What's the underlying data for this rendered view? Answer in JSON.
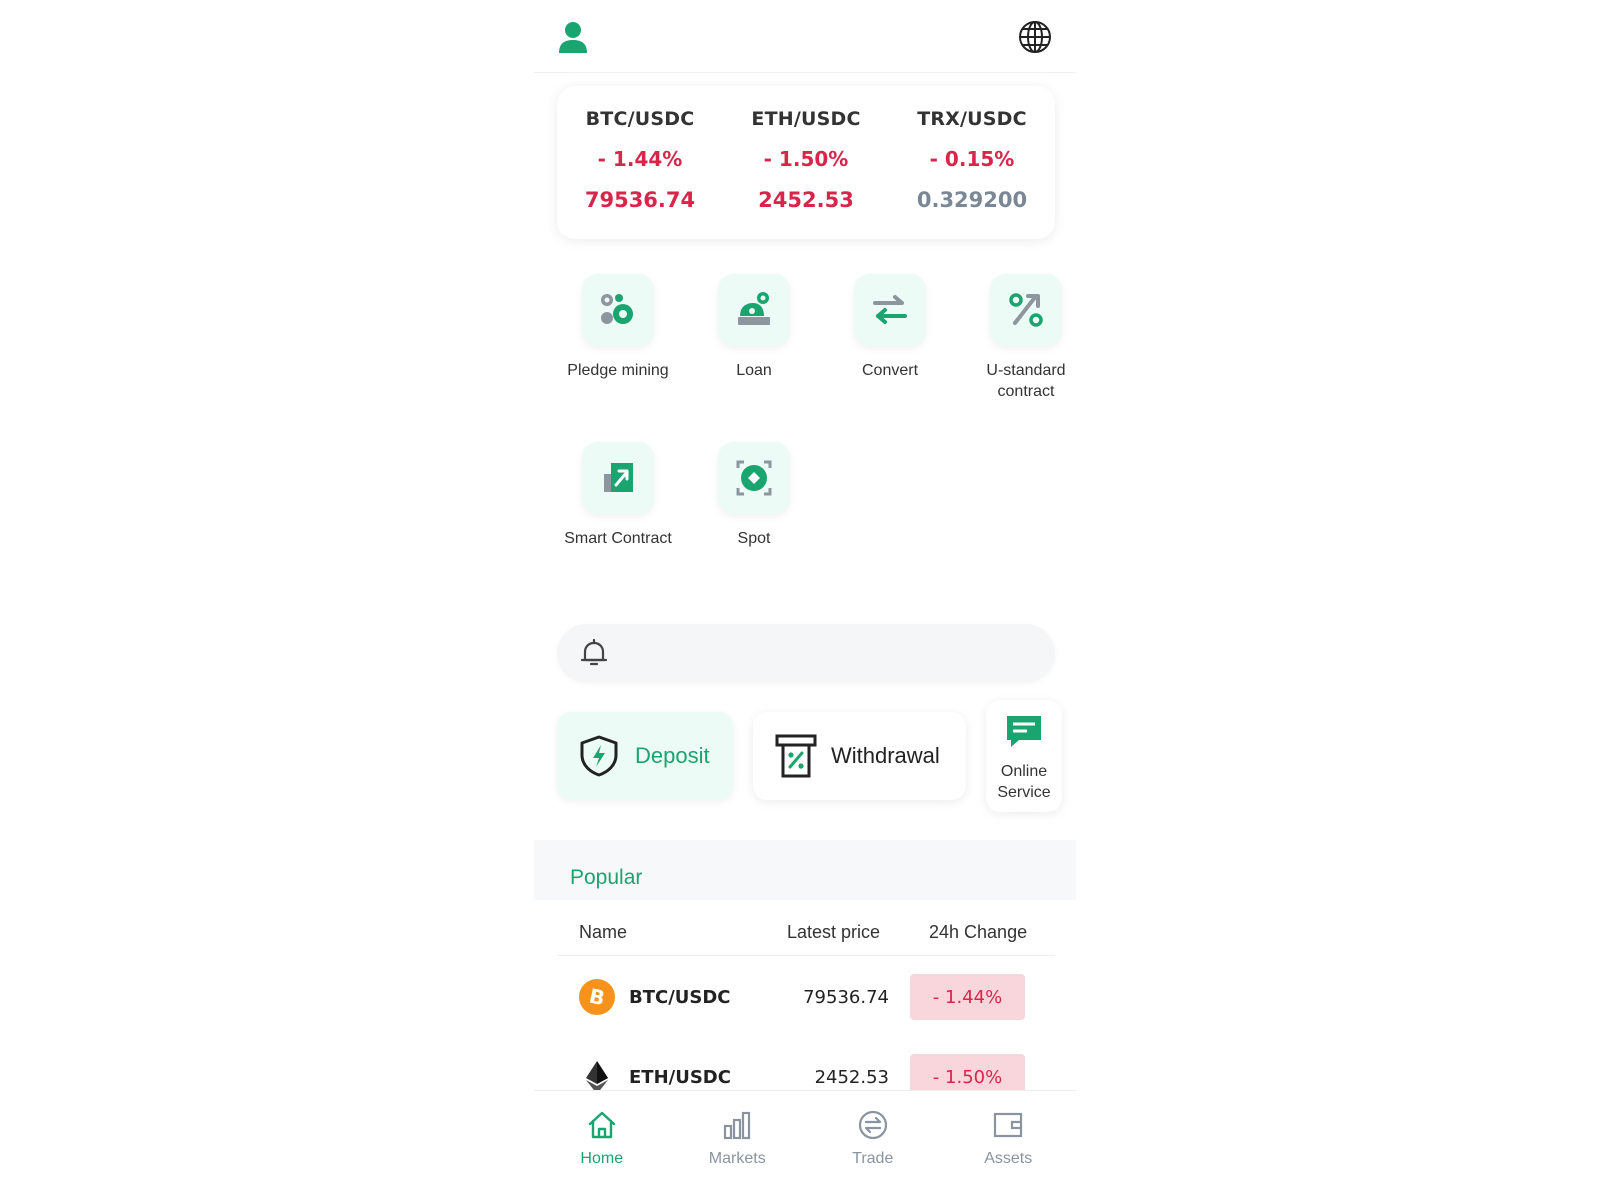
{
  "header": {
    "avatar_icon": "user-avatar-icon",
    "language_icon": "globe-icon"
  },
  "tickers": [
    {
      "pair": "BTC/USDC",
      "change": "- 1.44%",
      "price": "79536.74",
      "trend": "down"
    },
    {
      "pair": "ETH/USDC",
      "change": "- 1.50%",
      "price": "2452.53",
      "trend": "down"
    },
    {
      "pair": "TRX/USDC",
      "change": "- 0.15%",
      "price": "0.329200",
      "trend": "flat"
    }
  ],
  "quick_menu": [
    {
      "label": "Pledge mining",
      "icon": "pledge-mining-icon"
    },
    {
      "label": "Loan",
      "icon": "loan-icon"
    },
    {
      "label": "Convert",
      "icon": "convert-arrows-icon"
    },
    {
      "label": "U-standard contract",
      "icon": "percent-contract-icon"
    },
    {
      "label": "Smart Contract",
      "icon": "smart-contract-icon"
    },
    {
      "label": "Spot",
      "icon": "spot-icon"
    }
  ],
  "notice": {
    "icon": "bell-icon",
    "text": ""
  },
  "actions": {
    "deposit_label": "Deposit",
    "withdrawal_label": "Withdrawal",
    "service_label": "Online Service"
  },
  "popular": {
    "title": "Popular",
    "columns": {
      "name": "Name",
      "price": "Latest price",
      "change": "24h Change"
    },
    "rows": [
      {
        "pair": "BTC/USDC",
        "price": "79536.74",
        "change": "- 1.44%",
        "icon": "bitcoin-icon"
      },
      {
        "pair": "ETH/USDC",
        "price": "2452.53",
        "change": "- 1.50%",
        "icon": "ethereum-icon"
      }
    ]
  },
  "bottom_nav": [
    {
      "label": "Home",
      "icon": "home-icon",
      "active": true
    },
    {
      "label": "Markets",
      "icon": "bar-chart-icon",
      "active": false
    },
    {
      "label": "Trade",
      "icon": "trade-icon",
      "active": false
    },
    {
      "label": "Assets",
      "icon": "wallet-icon",
      "active": false
    }
  ],
  "colors": {
    "brand_green": "#1aa46f",
    "down_red": "#d9254a",
    "muted_gray": "#7a8794",
    "icon_bg": "#ecfbf6",
    "badge_red_bg": "#f9d5dc"
  }
}
